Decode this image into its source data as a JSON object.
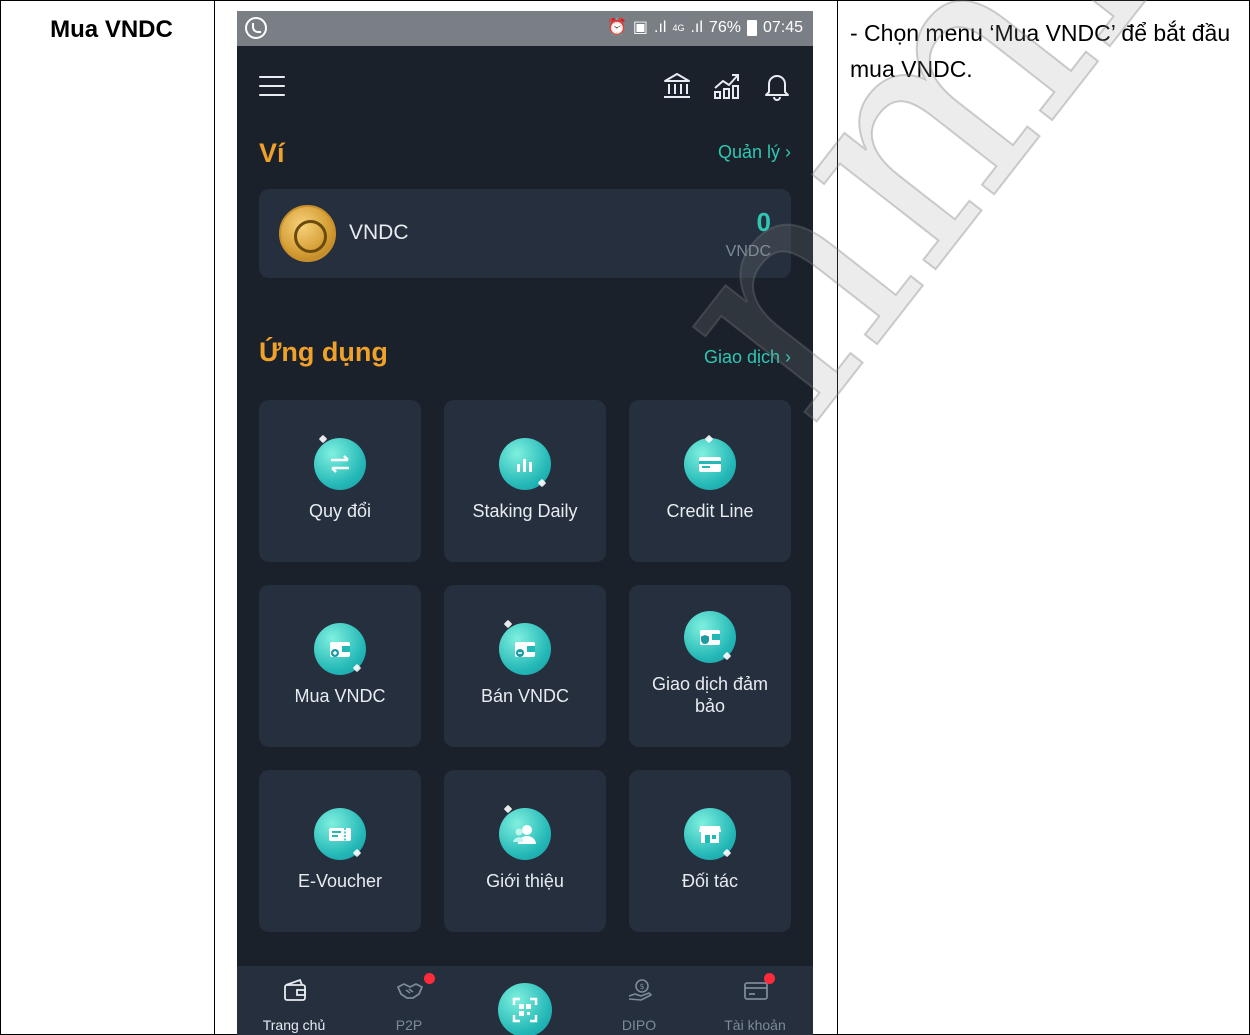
{
  "step": {
    "title": "Mua VNDC"
  },
  "description": "- Chọn menu ‘Mua VNDC’ để bắt đầu mua VNDC.",
  "watermark": "nmies",
  "phone": {
    "status_bar": {
      "battery": "76%",
      "time": "07:45",
      "network": "4G"
    },
    "wallet_section": {
      "title": "Ví",
      "link": "Quản lý ›",
      "card": {
        "name": "VNDC",
        "amount": "0",
        "unit": "VNDC"
      }
    },
    "apps_section": {
      "title": "Ứng dụng",
      "link": "Giao dịch ›",
      "tiles": [
        {
          "label": "Quy đổi",
          "icon": "exchange-icon"
        },
        {
          "label": "Staking Daily",
          "icon": "bar-chart-icon"
        },
        {
          "label": "Credit Line",
          "icon": "credit-card-icon"
        },
        {
          "label": "Mua VNDC",
          "icon": "wallet-plus-icon"
        },
        {
          "label": "Bán VNDC",
          "icon": "wallet-minus-icon"
        },
        {
          "label": "Giao dịch đảm bảo",
          "icon": "shield-wallet-icon"
        },
        {
          "label": "E-Voucher",
          "icon": "ticket-icon"
        },
        {
          "label": "Giới thiệu",
          "icon": "referral-icon"
        },
        {
          "label": "Đối tác",
          "icon": "store-icon"
        }
      ]
    },
    "bottom_nav": [
      {
        "label": "Trang chủ",
        "icon": "wallet-icon"
      },
      {
        "label": "P2P",
        "icon": "handshake-icon"
      },
      {
        "label": "",
        "icon": "qr-scan-icon"
      },
      {
        "label": "DIPO",
        "icon": "money-hand-icon"
      },
      {
        "label": "Tài khoản",
        "icon": "account-card-icon"
      }
    ]
  },
  "colors": {
    "phone_bg": "#1a212b",
    "card_bg": "#252f3d",
    "accent_orange": "#f0a12a",
    "accent_teal": "#2ec7b2",
    "notification_red": "#ff2b3a"
  }
}
